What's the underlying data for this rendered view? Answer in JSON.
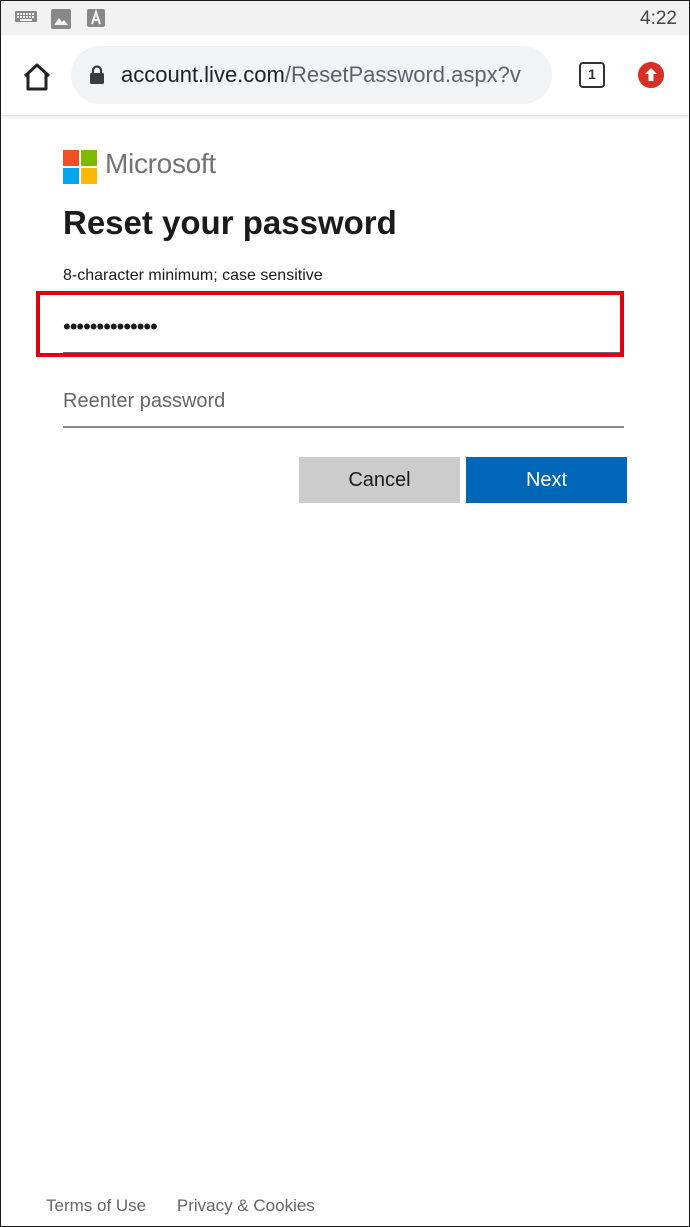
{
  "status_bar": {
    "time": "4:22",
    "icons": [
      "keyboard-icon",
      "image-icon",
      "font-icon"
    ]
  },
  "browser": {
    "url_host": "account.live.com",
    "url_path": "/ResetPassword.aspx?v",
    "tab_count": "1",
    "icons": [
      "home-icon",
      "lock-icon",
      "update-icon"
    ]
  },
  "page": {
    "brand": "Microsoft",
    "title": "Reset your password",
    "hint": "8-character minimum; case sensitive",
    "password_value": "••••••••••••••",
    "reenter_placeholder": "Reenter password",
    "cancel_label": "Cancel",
    "next_label": "Next",
    "highlight_color": "#e3000f",
    "accent_color": "#0067b8"
  },
  "footer": {
    "terms": "Terms of Use",
    "privacy": "Privacy & Cookies"
  }
}
